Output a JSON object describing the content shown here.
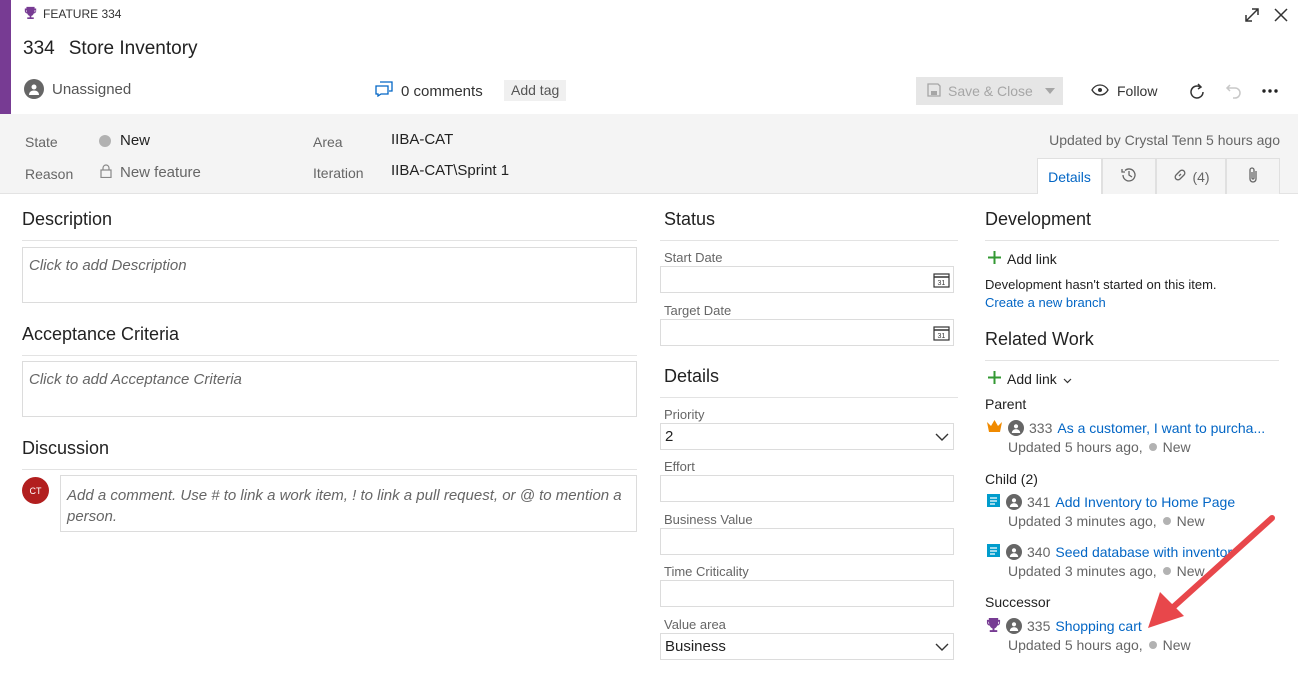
{
  "colors": {
    "accent": "#773b93",
    "link": "#0366c5",
    "add_green": "#339933",
    "arrow": "#e8474b",
    "avatar_red": "#b21f1f"
  },
  "header": {
    "type_label": "FEATURE 334",
    "id": "334",
    "title": "Store Inventory",
    "assigned": "Unassigned",
    "comments": "0 comments",
    "add_tag": "Add tag",
    "save_close": "Save & Close",
    "follow": "Follow"
  },
  "fields": {
    "state_label": "State",
    "state_value": "New",
    "reason_label": "Reason",
    "reason_value": "New feature",
    "area_label": "Area",
    "area_value": "IIBA-CAT",
    "iteration_label": "Iteration",
    "iteration_value": "IIBA-CAT\\Sprint 1",
    "updated": "Updated by Crystal Tenn 5 hours ago"
  },
  "tabs": {
    "details": "Details",
    "links": "(4)"
  },
  "left": {
    "description_title": "Description",
    "description_placeholder": "Click to add Description",
    "acceptance_title": "Acceptance Criteria",
    "acceptance_placeholder": "Click to add Acceptance Criteria",
    "discussion_title": "Discussion",
    "discussion_placeholder": "Add a comment. Use # to link a work item, ! to link a pull request, or @ to mention a person.",
    "avatar_initials": "CT"
  },
  "middle": {
    "status_title": "Status",
    "start_date_label": "Start Date",
    "target_date_label": "Target Date",
    "details_title": "Details",
    "priority_label": "Priority",
    "priority_value": "2",
    "effort_label": "Effort",
    "business_value_label": "Business Value",
    "time_criticality_label": "Time Criticality",
    "value_area_label": "Value area",
    "value_area_value": "Business"
  },
  "right": {
    "development_title": "Development",
    "add_link": "Add link",
    "dev_not_started": "Development hasn't started on this item.",
    "create_branch": "Create a new branch",
    "related_title": "Related Work",
    "related_add_link": "Add link",
    "parent_label": "Parent",
    "parent": {
      "id": "333",
      "title": "As a customer, I want to purcha...",
      "updated": "Updated 5 hours ago,",
      "state": "New"
    },
    "child_label": "Child (2)",
    "children": [
      {
        "id": "341",
        "title": "Add Inventory to Home Page",
        "updated": "Updated 3 minutes ago,",
        "state": "New"
      },
      {
        "id": "340",
        "title": "Seed database with inventor",
        "updated": "Updated 3 minutes ago,",
        "state": "New"
      }
    ],
    "successor_label": "Successor",
    "successor": {
      "id": "335",
      "title": "Shopping cart",
      "updated": "Updated 5 hours ago,",
      "state": "New"
    }
  }
}
